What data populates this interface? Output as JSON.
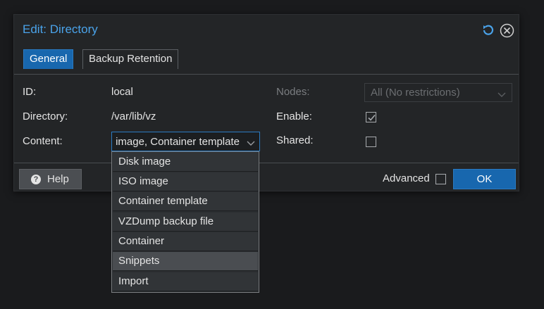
{
  "dialog": {
    "title": "Edit: Directory",
    "tools": {
      "reset_icon": "reset-icon",
      "close_icon": "close-icon"
    }
  },
  "tabs": [
    {
      "label": "General",
      "active": true
    },
    {
      "label": "Backup Retention",
      "active": false
    }
  ],
  "form": {
    "id_label": "ID:",
    "id_value": "local",
    "directory_label": "Directory:",
    "directory_value": "/var/lib/vz",
    "content_label": "Content:",
    "content_value": "Disk image, Container template",
    "nodes_label": "Nodes:",
    "nodes_value": "All (No restrictions)",
    "enable_label": "Enable:",
    "enable_checked": true,
    "shared_label": "Shared:",
    "shared_checked": false
  },
  "footer": {
    "help_label": "Help",
    "advanced_label": "Advanced",
    "advanced_checked": false,
    "ok_label": "OK"
  },
  "content_options": [
    {
      "label": "Disk image",
      "highlighted": false
    },
    {
      "label": "ISO image",
      "highlighted": false
    },
    {
      "label": "Container template",
      "highlighted": false
    },
    {
      "label": "VZDump backup file",
      "highlighted": false
    },
    {
      "label": "Container",
      "highlighted": false
    },
    {
      "label": "Snippets",
      "highlighted": true
    },
    {
      "label": "Import",
      "highlighted": false
    }
  ],
  "colors": {
    "accent": "#4aa3ea",
    "primary_button": "#1867ae",
    "background": "#232527"
  }
}
